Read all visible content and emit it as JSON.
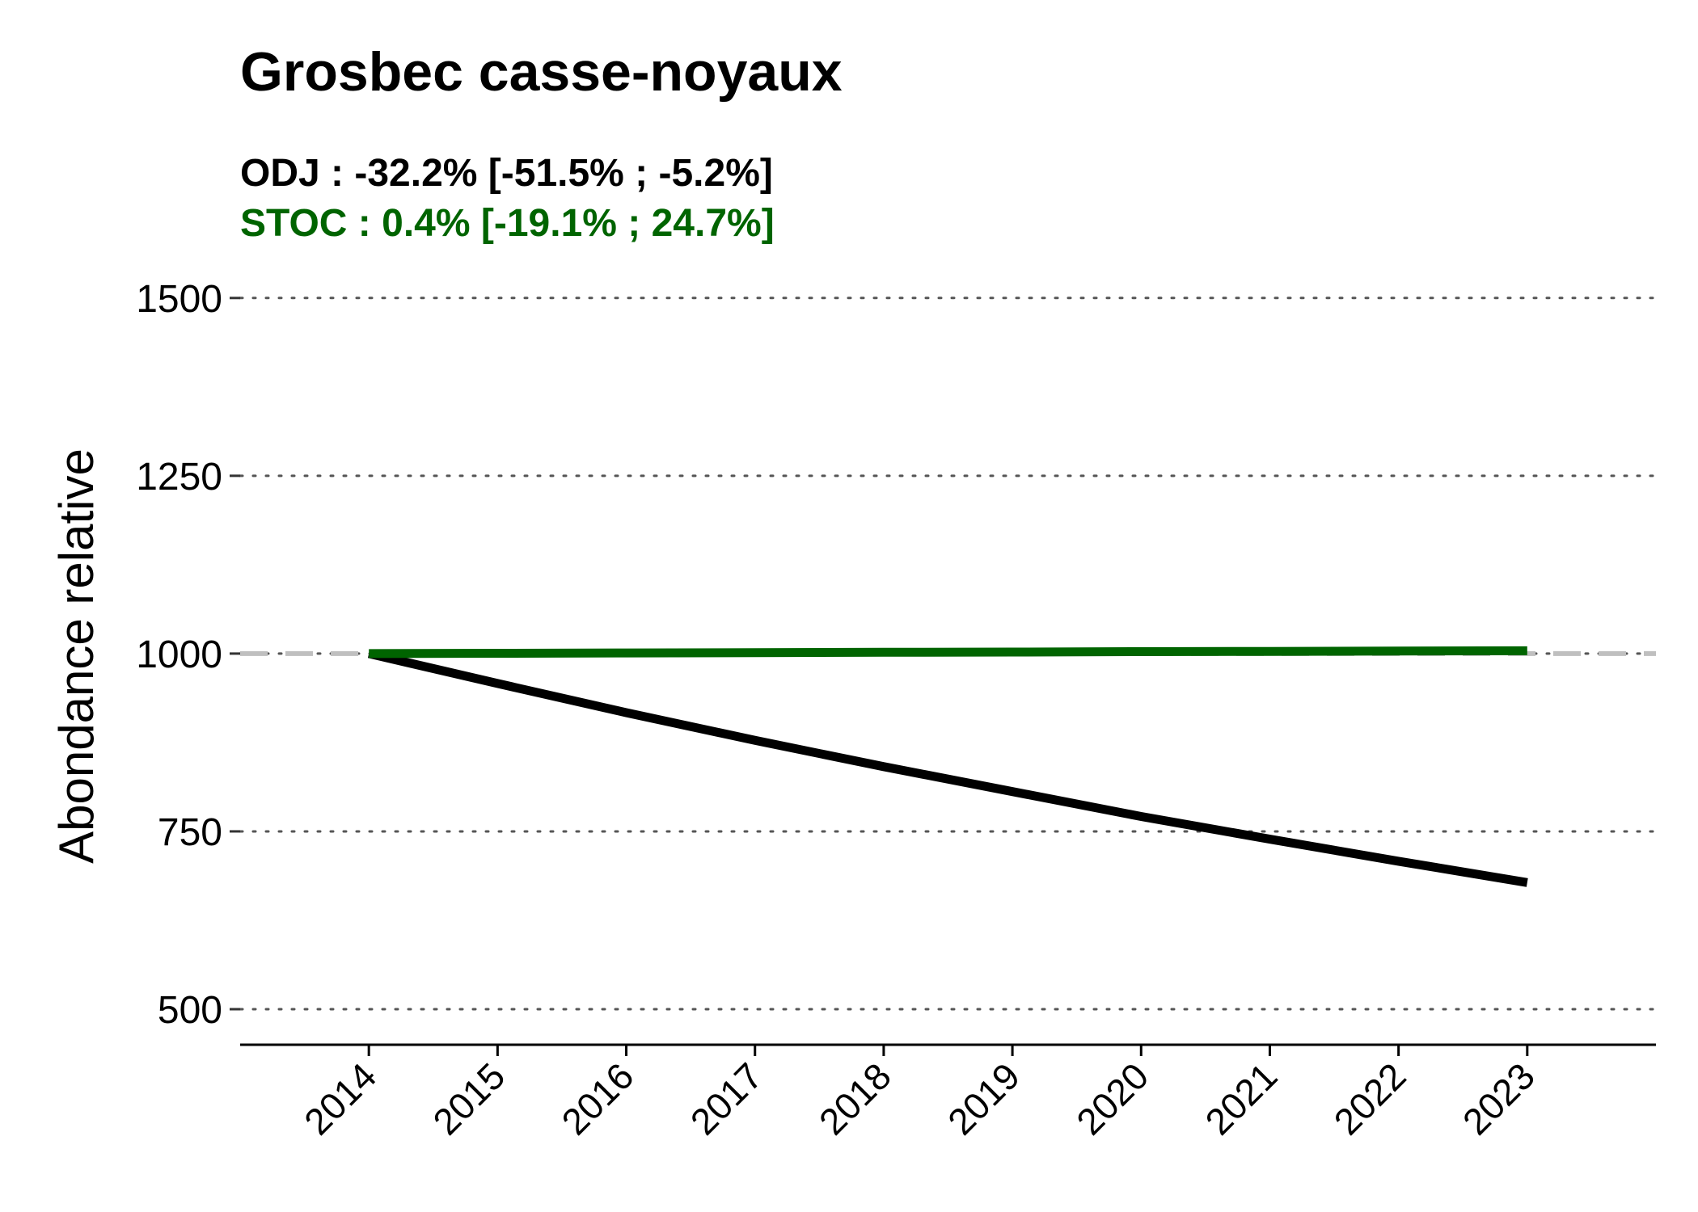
{
  "chart_data": {
    "type": "line",
    "title": "Grosbec casse-noyaux",
    "subtitles": [
      {
        "text": "ODJ : -32.2% [-51.5% ; -5.2%]",
        "color": "#000000"
      },
      {
        "text": "STOC : 0.4% [-19.1% ; 24.7%]",
        "color": "#006400"
      }
    ],
    "xlabel": "",
    "ylabel": "Abondance relative",
    "x": [
      2014,
      2015,
      2016,
      2017,
      2018,
      2019,
      2020,
      2021,
      2022,
      2023
    ],
    "xlim": [
      2013,
      2024
    ],
    "ylim": [
      450,
      1510
    ],
    "yticks": [
      500,
      750,
      1000,
      1250,
      1500
    ],
    "reference_line": {
      "y": 1000,
      "color": "#bfbfbf",
      "style": "dashed"
    },
    "grid": "horizontal dotted",
    "legend": "none",
    "series": [
      {
        "name": "ODJ",
        "color": "#000000",
        "values": [
          1000,
          958,
          917,
          878,
          841,
          806,
          771,
          739,
          708,
          678
        ]
      },
      {
        "name": "STOC",
        "color": "#006400",
        "values": [
          1000,
          1000.4,
          1000.9,
          1001.3,
          1001.8,
          1002.2,
          1002.7,
          1003.1,
          1003.6,
          1004
        ]
      }
    ]
  }
}
